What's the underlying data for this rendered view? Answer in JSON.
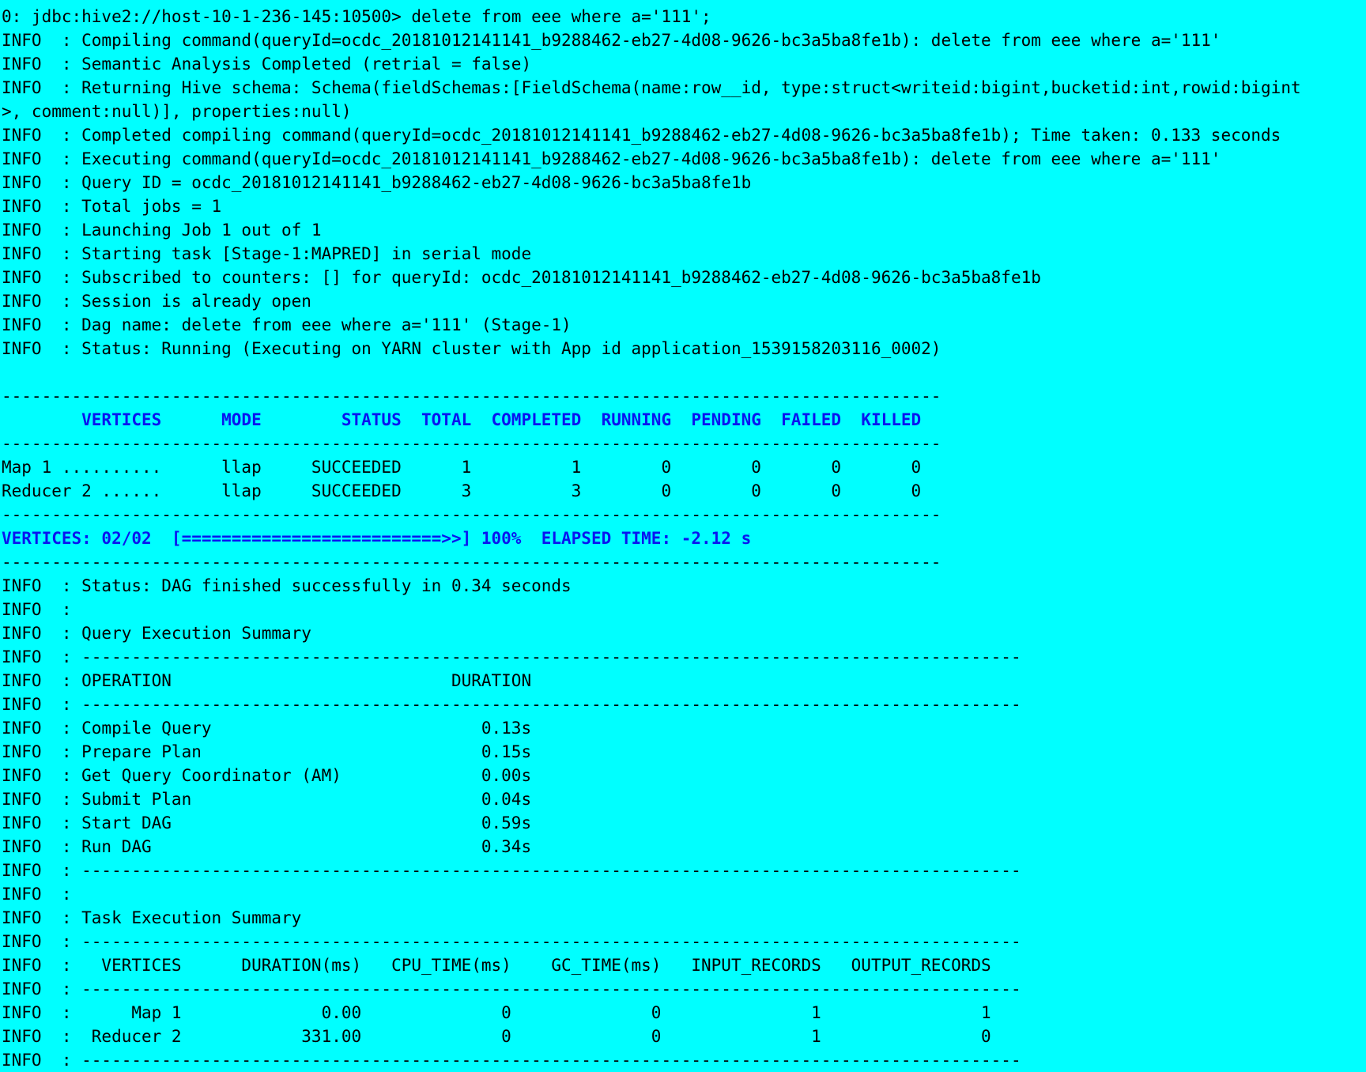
{
  "terminal": {
    "background": "#00ffff",
    "accent": "#0a14f0",
    "lines": [
      {
        "text": "0: jdbc:hive2://host-10-1-236-145:10500> delete from eee where a='111';",
        "style": ""
      },
      {
        "text": "INFO  : Compiling command(queryId=ocdc_20181012141141_b9288462-eb27-4d08-9626-bc3a5ba8fe1b): delete from eee where a='111'",
        "style": ""
      },
      {
        "text": "INFO  : Semantic Analysis Completed (retrial = false)",
        "style": ""
      },
      {
        "text": "INFO  : Returning Hive schema: Schema(fieldSchemas:[FieldSchema(name:row__id, type:struct<writeid:bigint,bucketid:int,rowid:bigint",
        "style": ""
      },
      {
        "text": ">, comment:null)], properties:null)",
        "style": ""
      },
      {
        "text": "INFO  : Completed compiling command(queryId=ocdc_20181012141141_b9288462-eb27-4d08-9626-bc3a5ba8fe1b); Time taken: 0.133 seconds",
        "style": ""
      },
      {
        "text": "INFO  : Executing command(queryId=ocdc_20181012141141_b9288462-eb27-4d08-9626-bc3a5ba8fe1b): delete from eee where a='111'",
        "style": ""
      },
      {
        "text": "INFO  : Query ID = ocdc_20181012141141_b9288462-eb27-4d08-9626-bc3a5ba8fe1b",
        "style": ""
      },
      {
        "text": "INFO  : Total jobs = 1",
        "style": ""
      },
      {
        "text": "INFO  : Launching Job 1 out of 1",
        "style": ""
      },
      {
        "text": "INFO  : Starting task [Stage-1:MAPRED] in serial mode",
        "style": ""
      },
      {
        "text": "INFO  : Subscribed to counters: [] for queryId: ocdc_20181012141141_b9288462-eb27-4d08-9626-bc3a5ba8fe1b",
        "style": ""
      },
      {
        "text": "INFO  : Session is already open",
        "style": ""
      },
      {
        "text": "INFO  : Dag name: delete from eee where a='111' (Stage-1)",
        "style": ""
      },
      {
        "text": "INFO  : Status: Running (Executing on YARN cluster with App id application_1539158203116_0002)",
        "style": ""
      },
      {
        "text": "",
        "style": ""
      },
      {
        "text": "----------------------------------------------------------------------------------------------",
        "style": "rule"
      },
      {
        "text": "        VERTICES      MODE        STATUS  TOTAL  COMPLETED  RUNNING  PENDING  FAILED  KILLED",
        "style": "blue"
      },
      {
        "text": "----------------------------------------------------------------------------------------------",
        "style": "rule"
      },
      {
        "text": "Map 1 ..........      llap     SUCCEEDED      1          1        0        0       0       0",
        "style": ""
      },
      {
        "text": "Reducer 2 ......      llap     SUCCEEDED      3          3        0        0       0       0",
        "style": ""
      },
      {
        "text": "----------------------------------------------------------------------------------------------",
        "style": "rule"
      },
      {
        "text": "VERTICES: 02/02  [==========================>>] 100%  ELAPSED TIME: -2.12 s",
        "style": "blue"
      },
      {
        "text": "----------------------------------------------------------------------------------------------",
        "style": "rule"
      },
      {
        "text": "INFO  : Status: DAG finished successfully in 0.34 seconds",
        "style": ""
      },
      {
        "text": "INFO  :",
        "style": ""
      },
      {
        "text": "INFO  : Query Execution Summary",
        "style": ""
      },
      {
        "text": "INFO  : ----------------------------------------------------------------------------------------------",
        "style": ""
      },
      {
        "text": "INFO  : OPERATION                            DURATION",
        "style": ""
      },
      {
        "text": "INFO  : ----------------------------------------------------------------------------------------------",
        "style": ""
      },
      {
        "text": "INFO  : Compile Query                           0.13s",
        "style": ""
      },
      {
        "text": "INFO  : Prepare Plan                            0.15s",
        "style": ""
      },
      {
        "text": "INFO  : Get Query Coordinator (AM)              0.00s",
        "style": ""
      },
      {
        "text": "INFO  : Submit Plan                             0.04s",
        "style": ""
      },
      {
        "text": "INFO  : Start DAG                               0.59s",
        "style": ""
      },
      {
        "text": "INFO  : Run DAG                                 0.34s",
        "style": ""
      },
      {
        "text": "INFO  : ----------------------------------------------------------------------------------------------",
        "style": ""
      },
      {
        "text": "INFO  :",
        "style": ""
      },
      {
        "text": "INFO  : Task Execution Summary",
        "style": ""
      },
      {
        "text": "INFO  : ----------------------------------------------------------------------------------------------",
        "style": ""
      },
      {
        "text": "INFO  :   VERTICES      DURATION(ms)   CPU_TIME(ms)    GC_TIME(ms)   INPUT_RECORDS   OUTPUT_RECORDS",
        "style": ""
      },
      {
        "text": "INFO  : ----------------------------------------------------------------------------------------------",
        "style": ""
      },
      {
        "text": "INFO  :      Map 1              0.00              0              0               1                1",
        "style": ""
      },
      {
        "text": "INFO  :  Reducer 2            331.00              0              0               1                0",
        "style": ""
      },
      {
        "text": "INFO  : ----------------------------------------------------------------------------------------------",
        "style": ""
      }
    ]
  }
}
